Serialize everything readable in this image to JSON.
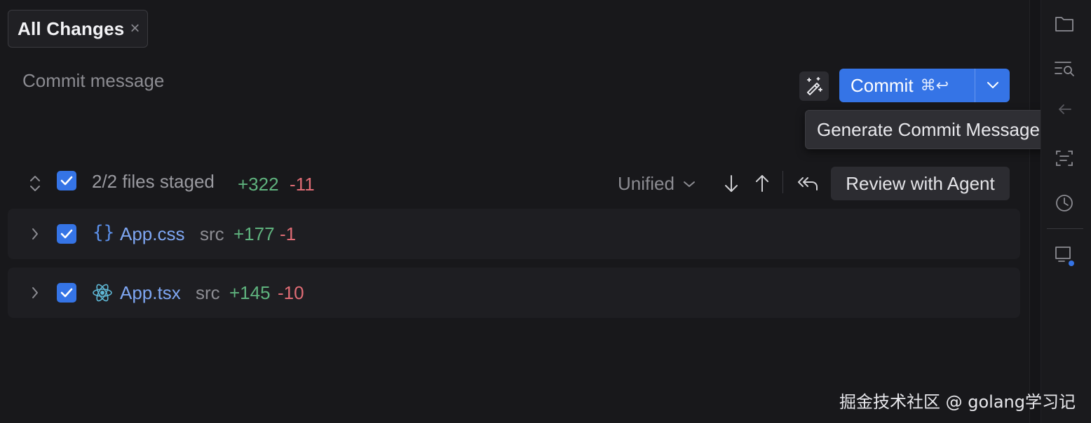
{
  "tab": {
    "label": "All Changes",
    "close_glyph": "×"
  },
  "commit": {
    "placeholder": "Commit message",
    "button_label": "Commit",
    "shortcut": "⌘↩",
    "tooltip": "Generate Commit Message",
    "accent_color": "#3574e6"
  },
  "staged": {
    "text": "2/2 files staged",
    "additions": "+322",
    "deletions": "-11",
    "view_mode": "Unified",
    "review_button": "Review with Agent"
  },
  "files": [
    {
      "name": "App.css",
      "dir": "src",
      "additions": "+177",
      "deletions": "-1",
      "icon": "css-braces-icon"
    },
    {
      "name": "App.tsx",
      "dir": "src",
      "additions": "+145",
      "deletions": "-10",
      "icon": "react-icon"
    }
  ],
  "sidebar": {
    "icons": [
      "folder-icon",
      "search-list-icon",
      "back-arrow-icon",
      "scan-text-icon",
      "history-icon",
      "terminal-notification-icon"
    ]
  },
  "watermark": "掘金技术社区 @ golang学习记"
}
